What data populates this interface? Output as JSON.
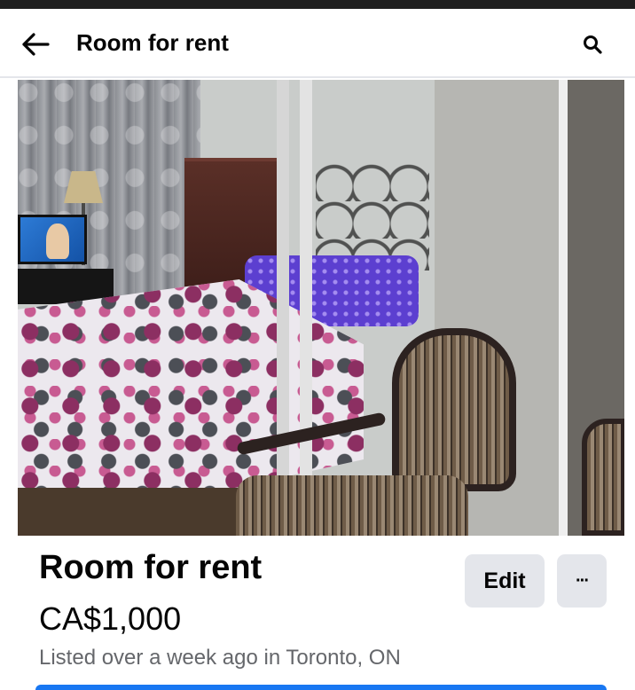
{
  "app_bar": {
    "title": "Room for rent",
    "back_icon": "arrow-left-icon",
    "search_icon": "search-icon"
  },
  "listing": {
    "title": "Room for rent",
    "price": "CA$1,000",
    "meta": "Listed over a week ago in Toronto, ON",
    "edit_label": "Edit",
    "more_label": "···"
  },
  "colors": {
    "primary": "#1877f2",
    "text": "#050505",
    "muted": "#65676b",
    "button_bg": "#e4e6eb"
  }
}
